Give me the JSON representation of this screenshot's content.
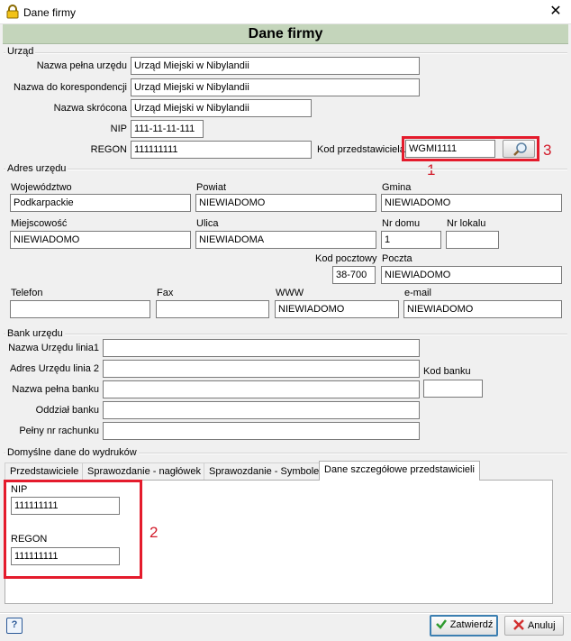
{
  "window": {
    "title": "Dane firmy",
    "close": "✕"
  },
  "header": {
    "title": "Dane firmy"
  },
  "urzad": {
    "group_label": "Urząd",
    "nazwa_pelna_label": "Nazwa pełna urzędu",
    "nazwa_pelna_value": "Urząd Miejski w Nibylandii",
    "nazwa_kor_label": "Nazwa do korespondencji",
    "nazwa_kor_value": "Urząd Miejski w Nibylandii",
    "nazwa_skr_label": "Nazwa skrócona",
    "nazwa_skr_value": "Urząd Miejski w Nibylandii",
    "nip_label": "NIP",
    "nip_value": "111-11-11-111",
    "regon_label": "REGON",
    "regon_value": "111111111",
    "kod_przedst_label": "Kod przedstawiciela",
    "kod_przedst_value": "WGMI1111"
  },
  "adres": {
    "group_label": "Adres urzędu",
    "wojewodztwo_label": "Województwo",
    "wojewodztwo_value": "Podkarpackie",
    "powiat_label": "Powiat",
    "powiat_value": "NIEWIADOMO",
    "gmina_label": "Gmina",
    "gmina_value": "NIEWIADOMO",
    "miejscowosc_label": "Miejscowość",
    "miejscowosc_value": "NIEWIADOMO",
    "ulica_label": "Ulica",
    "ulica_value": "NIEWIADOMA",
    "nr_domu_label": "Nr domu",
    "nr_domu_value": "1",
    "nr_lokalu_label": "Nr lokalu",
    "nr_lokalu_value": "",
    "kod_pocztowy_label": "Kod pocztowy",
    "kod_pocztowy_value": "38-700",
    "poczta_label": "Poczta",
    "poczta_value": "NIEWIADOMO",
    "telefon_label": "Telefon",
    "telefon_value": "",
    "fax_label": "Fax",
    "fax_value": "",
    "www_label": "WWW",
    "www_value": "NIEWIADOMO",
    "email_label": "e-mail",
    "email_value": "NIEWIADOMO"
  },
  "bank": {
    "group_label": "Bank urzędu",
    "linia1_label": "Nazwa Urzędu linia1",
    "linia1_value": "",
    "linia2_label": "Adres Urzędu linia 2",
    "linia2_value": "",
    "nazwa_banku_label": "Nazwa pełna banku",
    "nazwa_banku_value": "",
    "oddzial_label": "Oddział banku",
    "oddzial_value": "",
    "rachunek_label": "Pełny nr rachunku",
    "rachunek_value": "",
    "kod_banku_label": "Kod banku",
    "kod_banku_value": ""
  },
  "wydruki": {
    "group_label": "Domyślne dane do wydruków",
    "tabs": [
      "Przedstawiciele",
      "Sprawozdanie - nagłówek",
      "Sprawozdanie - Symbole",
      "Dane szczegółowe przedstawicieli"
    ],
    "active_tab": 3,
    "nip_label": "NIP",
    "nip_value": "111111111",
    "regon_label": "REGON",
    "regon_value": "111111111"
  },
  "annotations": {
    "a1": "1",
    "a2": "2",
    "a3": "3"
  },
  "footer": {
    "help": "?",
    "ok_label": "Zatwierdź",
    "cancel_label": "Anuluj"
  },
  "colors": {
    "header_bg": "#c4d5bb",
    "annotation_red": "#e41b2c",
    "ok_check": "#2e9a2e",
    "cancel_x": "#d23030"
  },
  "icons": {
    "app": "lock-icon",
    "search": "magnifier-icon",
    "ok": "check-icon",
    "cancel": "x-icon",
    "help": "question-icon"
  }
}
